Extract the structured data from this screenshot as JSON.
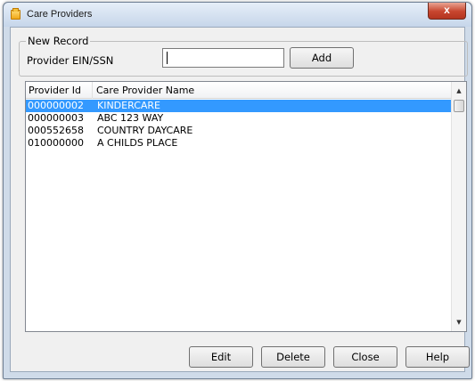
{
  "window": {
    "title": "Care Providers",
    "close_glyph": "x",
    "icon": "folder-icon"
  },
  "new_record": {
    "legend": "New Record",
    "ein_label": "Provider EIN/SSN",
    "ein_value": "",
    "add_label": "Add"
  },
  "list": {
    "columns": [
      "Provider Id",
      "Care Provider Name"
    ],
    "rows": [
      {
        "id": "000000002",
        "name": "KINDERCARE",
        "selected": true
      },
      {
        "id": "000000003",
        "name": "ABC 123 WAY",
        "selected": false
      },
      {
        "id": "000552658",
        "name": "COUNTRY DAYCARE",
        "selected": false
      },
      {
        "id": "010000000",
        "name": "A CHILDS PLACE",
        "selected": false
      }
    ],
    "scroll_up_glyph": "▲",
    "scroll_down_glyph": "▼"
  },
  "buttons": {
    "edit": "Edit",
    "delete": "Delete",
    "close": "Close",
    "help": "Help"
  },
  "colors": {
    "selection": "#3399ff",
    "window_frame": "#cfdbe9",
    "close_button": "#c7452e"
  }
}
